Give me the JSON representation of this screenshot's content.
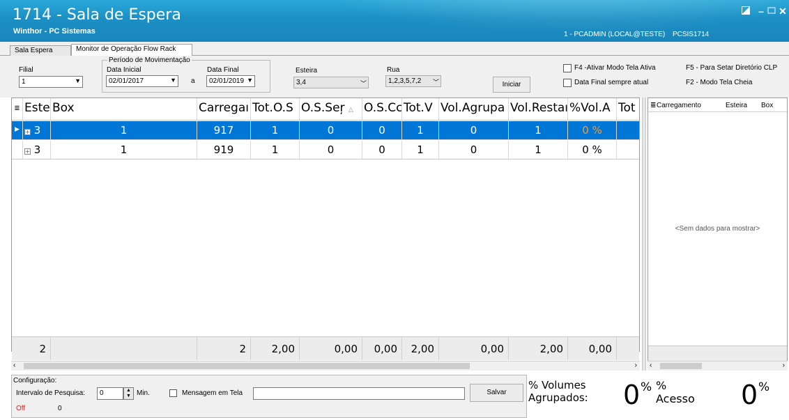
{
  "window": {
    "title": "1714 - Sala de Espera",
    "subtitle": "Winthor - PC Sistemas",
    "user": "1 - PCADMIN (LOCAL@TESTE)",
    "routine": "PCSIS1714"
  },
  "tabs": [
    {
      "label": "Sala Espera"
    },
    {
      "label": "Monitor de Operação Flow Rack"
    }
  ],
  "filters": {
    "filial_label": "Filial",
    "filial_value": "1",
    "periodo_label": "Período de Movimentação",
    "data_inicial_label": "Data Inicial",
    "data_inicial_value": "02/01/2017",
    "separator": "a",
    "data_final_label": "Data Final",
    "data_final_value": "02/01/2019",
    "esteira_label": "Esteira",
    "esteira_value": "3,4",
    "rua_label": "Rua",
    "rua_value": "1,2,3,5,7,2",
    "iniciar_label": "Iniciar",
    "f4_label": "F4 -Ativar Modo Tela Ativa",
    "data_final_atual_label": "Data Final sempre atual",
    "f5_label": "F5 - Para Setar  Diretório CLP",
    "f2_label": "F2 - Modo Tela Cheia"
  },
  "grid": {
    "headers": [
      "Este",
      "Box",
      "Carregaı",
      "Tot.O.S",
      "O.S.Seŗ",
      "O.S.Cc",
      "Tot.V",
      "Vol.Agrupa",
      "Vol.Restaı",
      "%Vol.A",
      "Tot"
    ],
    "rows": [
      [
        "3",
        "1",
        "917",
        "1",
        "0",
        "0",
        "1",
        "0",
        "1",
        "0 %",
        ""
      ],
      [
        "3",
        "1",
        "919",
        "1",
        "0",
        "0",
        "1",
        "0",
        "1",
        "0 %",
        ""
      ]
    ],
    "footer": [
      "2",
      "",
      "2",
      "2,00",
      "0,00",
      "0,00",
      "2,00",
      "0,00",
      "2,00",
      "0,00",
      ""
    ]
  },
  "sidegrid": {
    "headers": [
      "Carregamento",
      "Esteira",
      "Box"
    ],
    "empty_text": "<Sem dados para mostrar>"
  },
  "config": {
    "title": "Configuração:",
    "intervalo_label": "Intervalo de Pesquisa:",
    "intervalo_value": "0",
    "min_label": "Min.",
    "mensagem_label": "Mensagem em Tela",
    "salvar_label": "Salvar",
    "status_off": "Off",
    "status_count": "0"
  },
  "stats": {
    "volumes_label_1": "% Volumes",
    "volumes_label_2": "Agrupados:",
    "volumes_value": "0",
    "volumes_unit": "%",
    "acesso_label_1": "%",
    "acesso_label_2": "Acesso",
    "acesso_value": "0",
    "acesso_unit": "%"
  },
  "colors": {
    "titlebar": "#1b8fc4",
    "selection": "#0077d7",
    "pct_highlight": "#f29b3a",
    "off": "#e02020"
  }
}
